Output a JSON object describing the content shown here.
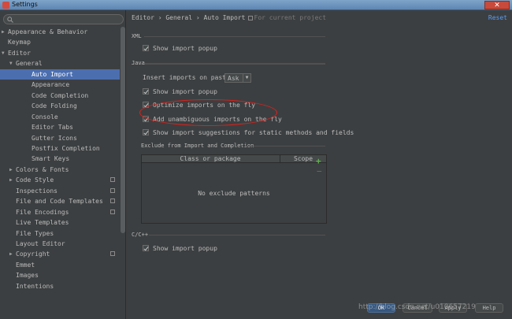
{
  "window": {
    "title": "Settings",
    "close_glyph": "✕"
  },
  "search": {
    "placeholder": "",
    "icon": "search-icon"
  },
  "tree": [
    {
      "label": "Appearance & Behavior",
      "arrow": "▶",
      "level": 0
    },
    {
      "label": "Keymap",
      "arrow": "",
      "level": 0
    },
    {
      "label": "Editor",
      "arrow": "▼",
      "level": 0
    },
    {
      "label": "General",
      "arrow": "▼",
      "level": 1
    },
    {
      "label": "Auto Import",
      "arrow": "",
      "level": 2,
      "selected": true
    },
    {
      "label": "Appearance",
      "arrow": "",
      "level": 2
    },
    {
      "label": "Code Completion",
      "arrow": "",
      "level": 2
    },
    {
      "label": "Code Folding",
      "arrow": "",
      "level": 2
    },
    {
      "label": "Console",
      "arrow": "",
      "level": 2
    },
    {
      "label": "Editor Tabs",
      "arrow": "",
      "level": 2
    },
    {
      "label": "Gutter Icons",
      "arrow": "",
      "level": 2
    },
    {
      "label": "Postfix Completion",
      "arrow": "",
      "level": 2
    },
    {
      "label": "Smart Keys",
      "arrow": "",
      "level": 2
    },
    {
      "label": "Colors & Fonts",
      "arrow": "▶",
      "level": 1
    },
    {
      "label": "Code Style",
      "arrow": "▶",
      "level": 1,
      "project": true
    },
    {
      "label": "Inspections",
      "arrow": "",
      "level": 1,
      "project": true
    },
    {
      "label": "File and Code Templates",
      "arrow": "",
      "level": 1,
      "project": true
    },
    {
      "label": "File Encodings",
      "arrow": "",
      "level": 1,
      "project": true
    },
    {
      "label": "Live Templates",
      "arrow": "",
      "level": 1
    },
    {
      "label": "File Types",
      "arrow": "",
      "level": 1
    },
    {
      "label": "Layout Editor",
      "arrow": "",
      "level": 1
    },
    {
      "label": "Copyright",
      "arrow": "▶",
      "level": 1,
      "project": true
    },
    {
      "label": "Emmet",
      "arrow": "",
      "level": 1
    },
    {
      "label": "Images",
      "arrow": "",
      "level": 1
    },
    {
      "label": "Intentions",
      "arrow": "",
      "level": 1
    }
  ],
  "breadcrumb": {
    "path": "Editor › General › Auto Import",
    "project_note": "For current project"
  },
  "reset_label": "Reset",
  "xml": {
    "title": "XML",
    "show_import_popup": {
      "label": "Show import popup",
      "checked": true
    }
  },
  "java": {
    "title": "Java",
    "insert_label": "Insert imports on paste:",
    "insert_value": "Ask",
    "show_import_popup": {
      "label": "Show import popup",
      "checked": true
    },
    "optimize": {
      "label": "Optimize imports on the fly",
      "checked": true
    },
    "unambiguous": {
      "label": "Add unambiguous imports on the fly",
      "checked": true
    },
    "suggestions": {
      "label": "Show import suggestions for static methods and fields",
      "checked": true
    },
    "exclude_title": "Exclude from Import and Completion",
    "col_class": "Class or package",
    "col_scope": "Scope",
    "empty_text": "No exclude patterns",
    "add_glyph": "+",
    "remove_glyph": "−"
  },
  "cpp": {
    "title": "C/C++",
    "show_import_popup": {
      "label": "Show import popup",
      "checked": true
    }
  },
  "buttons": {
    "ok": "OK",
    "cancel": "Cancel",
    "apply": "Apply",
    "help": "Help"
  },
  "watermark": "http://blog.csdn.net/u010657219",
  "colors": {
    "accent": "#4b6eaf",
    "link": "#589df6",
    "highlight_ring": "#e0201a",
    "add_green": "#5fb34f"
  }
}
